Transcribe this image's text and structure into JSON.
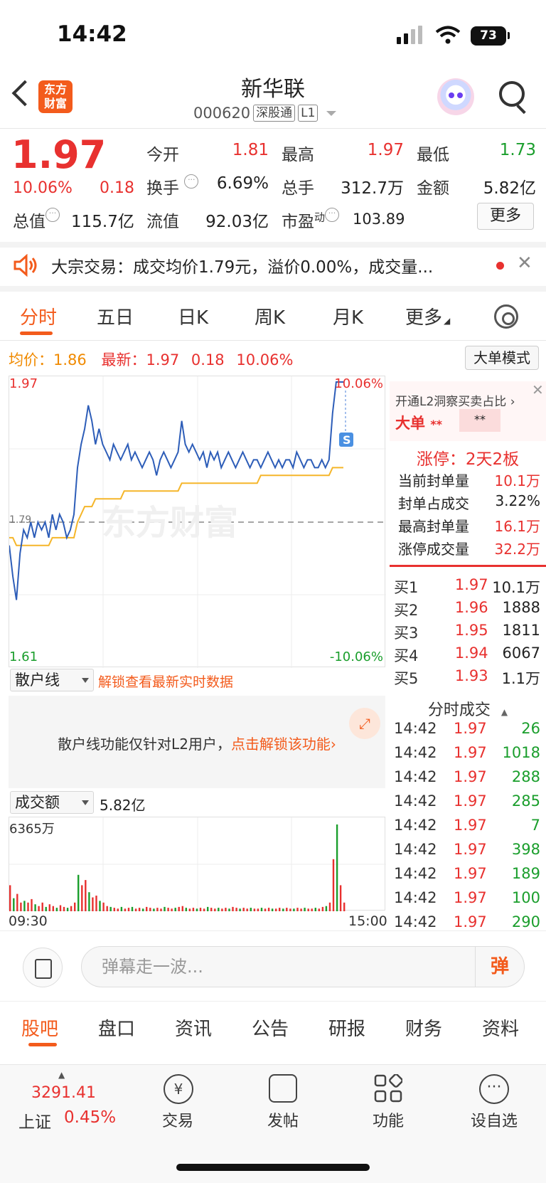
{
  "status_bar": {
    "time": "14:42",
    "battery": "73"
  },
  "header": {
    "logo_text": "东方\n财富",
    "stock_name": "新华联",
    "stock_code": "000620",
    "tag_connect": "深股通",
    "tag_level": "L1"
  },
  "quote": {
    "price": "1.97",
    "change_pct": "10.06%",
    "change_amt": "0.18",
    "open_label": "今开",
    "open": "1.81",
    "high_label": "最高",
    "high": "1.97",
    "low_label": "最低",
    "low": "1.73",
    "turnover_label": "换手",
    "turnover": "6.69%",
    "volume_label": "总手",
    "volume": "312.7万",
    "amount_label": "金额",
    "amount": "5.82亿",
    "mktcap_label": "总值",
    "mktcap": "115.7亿",
    "float_label": "流值",
    "float_cap": "92.03亿",
    "pe_label": "市盈",
    "pe_sup": "动",
    "pe": "103.89",
    "more_button": "更多"
  },
  "notice": {
    "text": "大宗交易：成交均价1.79元，溢价0.00%，成交量..."
  },
  "period_tabs": [
    "分时",
    "五日",
    "日K",
    "周K",
    "月K",
    "更多"
  ],
  "info_bar": {
    "avg_label": "均价：",
    "avg": "1.86",
    "latest_label": "最新：",
    "latest": "1.97",
    "chg": "0.18",
    "pct": "10.06%",
    "mode_button": "大单模式"
  },
  "chart_labels": {
    "y_top": "1.97",
    "y_bottom": "1.61",
    "pct_top": "10.06%",
    "pct_bottom": "-10.06%",
    "mid_price": "1.79",
    "watermark": "东方财富",
    "marker": "S"
  },
  "chart_data": {
    "type": "line",
    "ylim": [
      1.61,
      1.97
    ],
    "series": [
      {
        "values": [
          1.76,
          1.72,
          1.69,
          1.75,
          1.78,
          1.77,
          1.79,
          1.77,
          1.79,
          1.78,
          1.79,
          1.77,
          1.8,
          1.78,
          1.8,
          1.79,
          1.77,
          1.78,
          1.8,
          1.86,
          1.89,
          1.91,
          1.94,
          1.92,
          1.89,
          1.91,
          1.89,
          1.88,
          1.87,
          1.89,
          1.88,
          1.87,
          1.88,
          1.89,
          1.87,
          1.88,
          1.87,
          1.86,
          1.87,
          1.88,
          1.87,
          1.85,
          1.87,
          1.88,
          1.87,
          1.86,
          1.87,
          1.88,
          1.92,
          1.89,
          1.88,
          1.89,
          1.88,
          1.87,
          1.88,
          1.86,
          1.88,
          1.87,
          1.88,
          1.86,
          1.87,
          1.88,
          1.87,
          1.86,
          1.87,
          1.88,
          1.87,
          1.86,
          1.87,
          1.87,
          1.86,
          1.87,
          1.88,
          1.87,
          1.86,
          1.87,
          1.86,
          1.87,
          1.87,
          1.86,
          1.88,
          1.87,
          1.86,
          1.87,
          1.87,
          1.86,
          1.86,
          1.87,
          1.86,
          1.87,
          1.93,
          1.97,
          1.97,
          1.97
        ]
      },
      {
        "values": [
          1.77,
          1.77,
          1.76,
          1.76,
          1.76,
          1.76,
          1.76,
          1.76,
          1.76,
          1.76,
          1.76,
          1.76,
          1.77,
          1.77,
          1.77,
          1.77,
          1.77,
          1.77,
          1.77,
          1.79,
          1.8,
          1.81,
          1.81,
          1.81,
          1.82,
          1.82,
          1.82,
          1.82,
          1.82,
          1.82,
          1.82,
          1.82,
          1.83,
          1.83,
          1.83,
          1.83,
          1.83,
          1.83,
          1.83,
          1.83,
          1.83,
          1.83,
          1.83,
          1.83,
          1.83,
          1.83,
          1.83,
          1.83,
          1.84,
          1.84,
          1.84,
          1.84,
          1.84,
          1.84,
          1.84,
          1.84,
          1.84,
          1.84,
          1.84,
          1.84,
          1.84,
          1.84,
          1.84,
          1.84,
          1.84,
          1.84,
          1.84,
          1.84,
          1.84,
          1.84,
          1.85,
          1.85,
          1.85,
          1.85,
          1.85,
          1.85,
          1.85,
          1.85,
          1.85,
          1.85,
          1.85,
          1.85,
          1.85,
          1.85,
          1.85,
          1.85,
          1.85,
          1.85,
          1.85,
          1.85,
          1.86,
          1.86,
          1.86,
          1.86
        ]
      }
    ],
    "volume": [
      0.3,
      0.15,
      0.2,
      0.1,
      0.12,
      0.1,
      0.14,
      0.08,
      0.06,
      0.1,
      0.05,
      0.08,
      0.06,
      0.04,
      0.07,
      0.05,
      0.04,
      0.06,
      0.1,
      0.42,
      0.3,
      0.36,
      0.22,
      0.16,
      0.18,
      0.12,
      0.1,
      0.06,
      0.05,
      0.04,
      0.03,
      0.05,
      0.03,
      0.04,
      0.05,
      0.03,
      0.04,
      0.03,
      0.05,
      0.04,
      0.03,
      0.04,
      0.03,
      0.05,
      0.04,
      0.03,
      0.04,
      0.05,
      0.06,
      0.04,
      0.03,
      0.04,
      0.03,
      0.04,
      0.03,
      0.05,
      0.04,
      0.03,
      0.04,
      0.03,
      0.04,
      0.03,
      0.05,
      0.04,
      0.03,
      0.04,
      0.03,
      0.04,
      0.03,
      0.03,
      0.04,
      0.03,
      0.04,
      0.03,
      0.03,
      0.04,
      0.03,
      0.04,
      0.03,
      0.03,
      0.04,
      0.03,
      0.04,
      0.03,
      0.03,
      0.04,
      0.03,
      0.05,
      0.06,
      0.1,
      0.6,
      1.0,
      0.3,
      0.1
    ],
    "volume_max_label": "6365万",
    "x_start": "09:30",
    "x_end": "15:00"
  },
  "l2_panel": {
    "title": "开通L2洞察买卖占比 ›",
    "big_order_label": "大单",
    "big_order_stars": "**",
    "masked": "**",
    "limit_title": "涨停：2天2板",
    "rows": [
      {
        "label": "当前封单量",
        "value": "10.1万"
      },
      {
        "label": "封单占成交",
        "value": "3.22%"
      },
      {
        "label": "最高封单量",
        "value": "16.1万"
      },
      {
        "label": "涨停成交量",
        "value": "32.2万"
      }
    ]
  },
  "order_book": [
    {
      "label": "买1",
      "price": "1.97",
      "vol": "10.1万"
    },
    {
      "label": "买2",
      "price": "1.96",
      "vol": "1888"
    },
    {
      "label": "买3",
      "price": "1.95",
      "vol": "1811"
    },
    {
      "label": "买4",
      "price": "1.94",
      "vol": "6067"
    },
    {
      "label": "买5",
      "price": "1.93",
      "vol": "1.1万"
    }
  ],
  "trades": {
    "title": "分时成交",
    "rows": [
      {
        "time": "14:42",
        "price": "1.97",
        "vol": "26"
      },
      {
        "time": "14:42",
        "price": "1.97",
        "vol": "1018"
      },
      {
        "time": "14:42",
        "price": "1.97",
        "vol": "288"
      },
      {
        "time": "14:42",
        "price": "1.97",
        "vol": "285"
      },
      {
        "time": "14:42",
        "price": "1.97",
        "vol": "7"
      },
      {
        "time": "14:42",
        "price": "1.97",
        "vol": "398"
      },
      {
        "time": "14:42",
        "price": "1.97",
        "vol": "189"
      },
      {
        "time": "14:42",
        "price": "1.97",
        "vol": "100"
      },
      {
        "time": "14:42",
        "price": "1.97",
        "vol": "290"
      }
    ]
  },
  "retail": {
    "select_label": "散户线",
    "unlock_link": "解锁查看最新实时数据",
    "message": "散户线功能仅针对L2用户，",
    "message_link": "点击解锁该功能›"
  },
  "volume_section": {
    "select_label": "成交额",
    "value": "5.82亿"
  },
  "danmu": {
    "placeholder": "弹幕走一波...",
    "button": "弹"
  },
  "bottom_tabs": [
    "股吧",
    "盘口",
    "资讯",
    "公告",
    "研报",
    "财务",
    "资料"
  ],
  "bottom_nav": {
    "index_value": "3291.41",
    "index_name": "上证",
    "index_pct": "0.45%",
    "items": [
      "交易",
      "发帖",
      "功能",
      "设自选"
    ]
  }
}
